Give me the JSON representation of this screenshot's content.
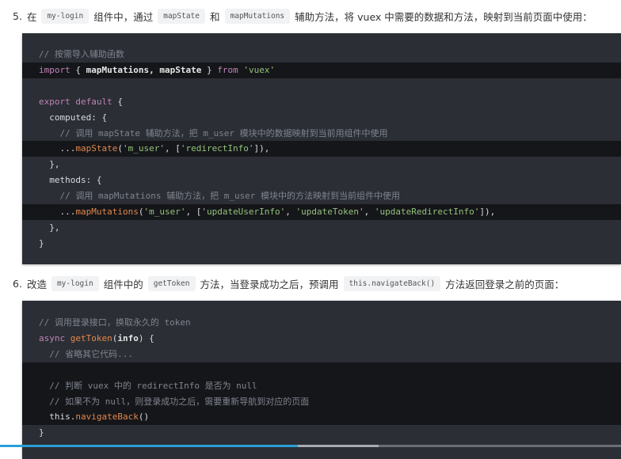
{
  "step5": {
    "num": "5.",
    "parts": [
      "在",
      "my-login",
      "组件中，通过",
      "mapState",
      "和",
      "mapMutations",
      "辅助方法，将 vuex 中需要的数据和方法，映射到当前页面中使用："
    ]
  },
  "step6": {
    "num": "6.",
    "parts": [
      "改造",
      "my-login",
      "组件中的",
      "getToken",
      "方法，当登录成功之后，预调用",
      "this.navigateBack()",
      "方法返回登录之前的页面："
    ]
  },
  "code1": [
    {
      "hl": false,
      "t": [
        [
          "// 按需导入辅助函数",
          "c"
        ]
      ]
    },
    {
      "hl": true,
      "t": [
        [
          "import",
          "k"
        ],
        [
          " { ",
          ""
        ],
        [
          "mapMutations, mapState",
          "b"
        ],
        [
          " } ",
          ""
        ],
        [
          "from",
          "k"
        ],
        [
          " ",
          ""
        ],
        [
          "'vuex'",
          "s"
        ]
      ]
    },
    {
      "hl": false,
      "t": []
    },
    {
      "hl": false,
      "t": [
        [
          "export default",
          "k"
        ],
        [
          " {",
          ""
        ]
      ]
    },
    {
      "hl": false,
      "t": [
        [
          "  computed",
          ""
        ],
        [
          ": {",
          ""
        ]
      ]
    },
    {
      "hl": false,
      "t": [
        [
          "    // 调用 mapState 辅助方法，把 m_user 模块中的数据映射到当前用组件中使用",
          "c"
        ]
      ]
    },
    {
      "hl": true,
      "t": [
        [
          "    ...",
          ""
        ],
        [
          "mapState",
          "f"
        ],
        [
          "(",
          ""
        ],
        [
          "'m_user'",
          "s"
        ],
        [
          ", [",
          ""
        ],
        [
          "'redirectInfo'",
          "s"
        ],
        [
          "]),",
          ""
        ]
      ]
    },
    {
      "hl": false,
      "t": [
        [
          "  },",
          ""
        ]
      ]
    },
    {
      "hl": false,
      "t": [
        [
          "  methods",
          ""
        ],
        [
          ": {",
          ""
        ]
      ]
    },
    {
      "hl": false,
      "t": [
        [
          "    // 调用 mapMutations 辅助方法，把 m_user 模块中的方法映射到当前组件中使用",
          "c"
        ]
      ]
    },
    {
      "hl": true,
      "t": [
        [
          "    ...",
          ""
        ],
        [
          "mapMutations",
          "f"
        ],
        [
          "(",
          ""
        ],
        [
          "'m_user'",
          "s"
        ],
        [
          ", [",
          ""
        ],
        [
          "'updateUserInfo'",
          "s"
        ],
        [
          ", ",
          ""
        ],
        [
          "'updateToken'",
          "s"
        ],
        [
          ", ",
          ""
        ],
        [
          "'updateRedirectInfo'",
          "s"
        ],
        [
          "]),",
          ""
        ]
      ]
    },
    {
      "hl": false,
      "t": [
        [
          "  },",
          ""
        ]
      ]
    },
    {
      "hl": false,
      "t": [
        [
          "}",
          ""
        ]
      ]
    }
  ],
  "code2": [
    {
      "hl": false,
      "t": [
        [
          "// 调用登录接口，换取永久的 token",
          "c"
        ]
      ]
    },
    {
      "hl": false,
      "t": [
        [
          "async",
          "k"
        ],
        [
          " ",
          ""
        ],
        [
          "getToken",
          "f"
        ],
        [
          "(",
          ""
        ],
        [
          "info",
          "b"
        ],
        [
          ") {",
          ""
        ]
      ]
    },
    {
      "hl": false,
      "t": [
        [
          "  // 省略其它代码...",
          "c"
        ]
      ]
    },
    {
      "hl": true,
      "t": []
    },
    {
      "hl": true,
      "t": [
        [
          "  // 判断 vuex 中的 redirectInfo 是否为 null",
          "c"
        ]
      ]
    },
    {
      "hl": true,
      "t": [
        [
          "  // 如果不为 null，则登录成功之后，需要重新导航到对应的页面",
          "c"
        ]
      ]
    },
    {
      "hl": true,
      "t": [
        [
          "  this",
          ""
        ],
        [
          ".",
          ""
        ],
        [
          "navigateBack",
          "f"
        ],
        [
          "()",
          ""
        ]
      ]
    },
    {
      "hl": false,
      "t": [
        [
          "}",
          ""
        ]
      ]
    }
  ],
  "video": {
    "played_fraction": 0.48,
    "buffered_fraction": 0.61
  }
}
